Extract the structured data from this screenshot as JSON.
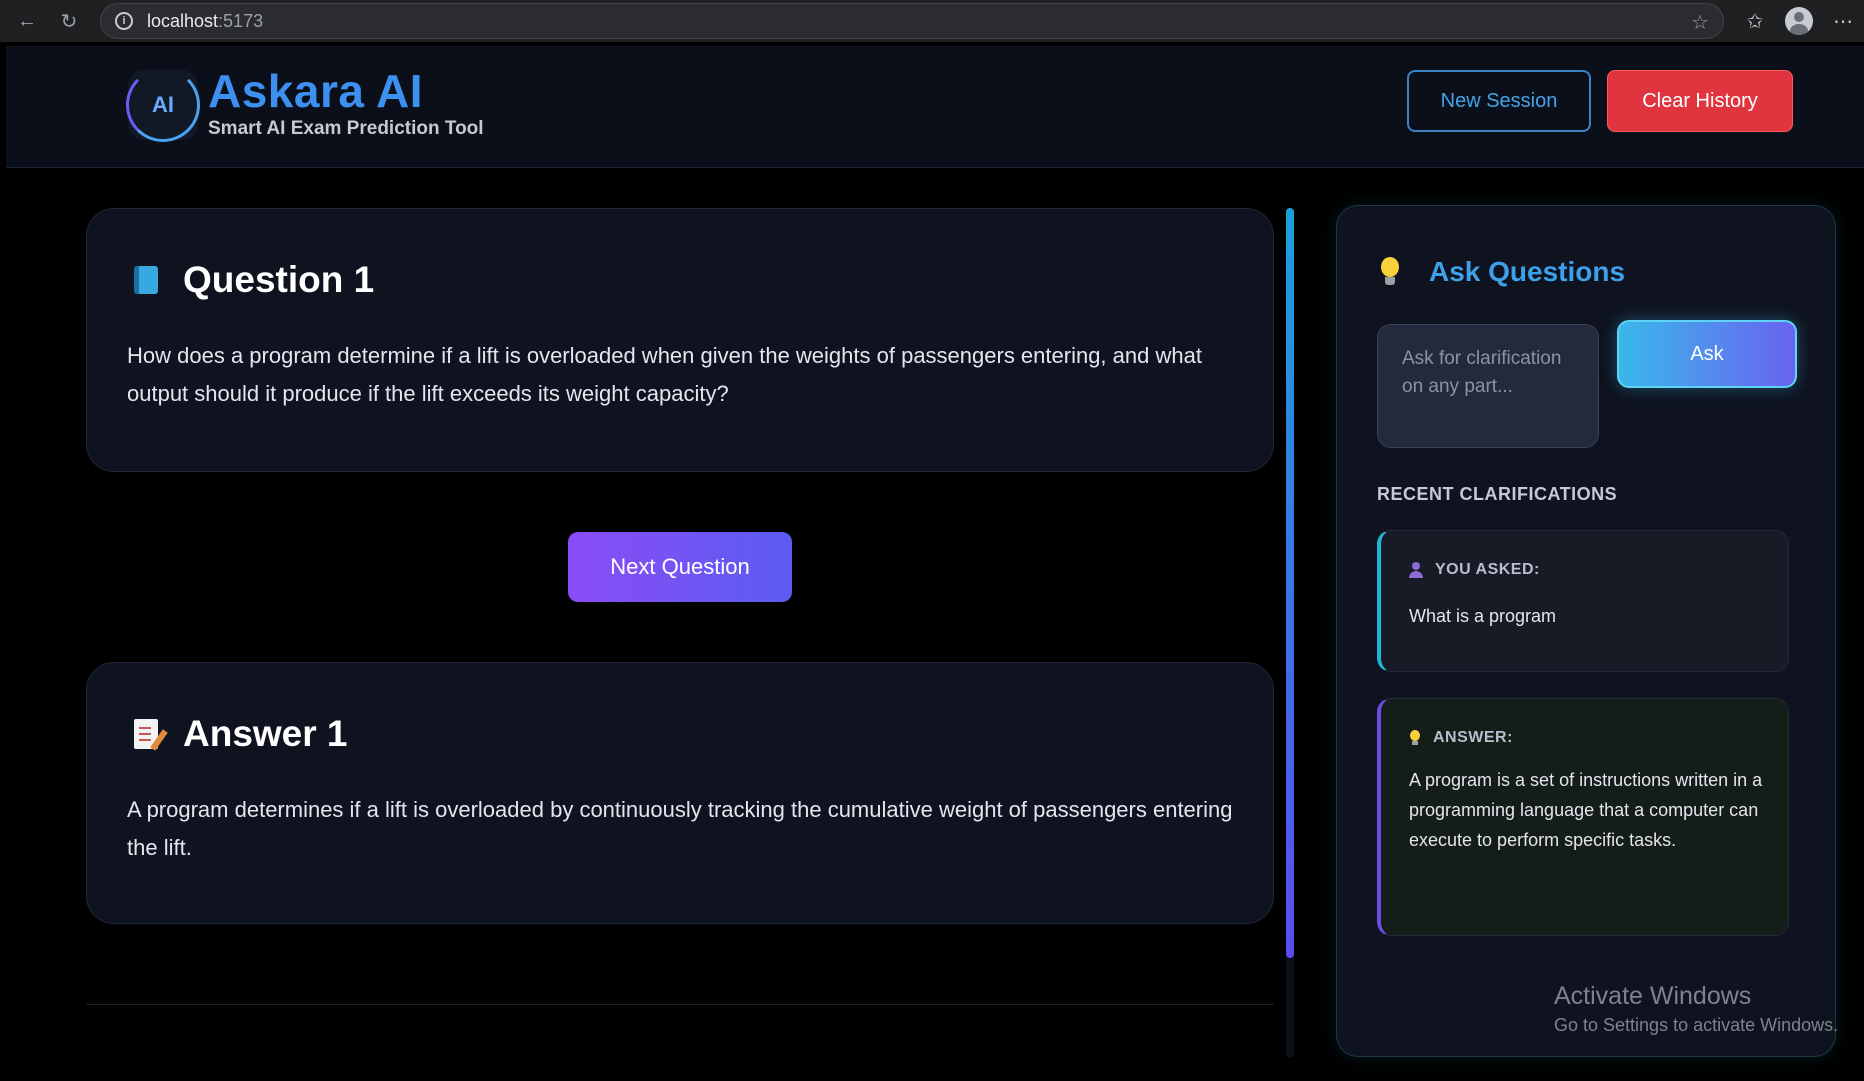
{
  "browser": {
    "url_host": "localhost",
    "url_port": ":5173"
  },
  "header": {
    "logo_text": "AI",
    "title": "Askara AI",
    "subtitle": "Smart AI Exam Prediction Tool",
    "new_session_label": "New Session",
    "clear_history_label": "Clear History"
  },
  "question": {
    "title": "Question 1",
    "text": "How does a program determine if a lift is overloaded when given the weights of passengers entering, and what output should it produce if the lift exceeds its weight capacity?"
  },
  "next_label": "Next Question",
  "answer": {
    "title": "Answer 1",
    "text": "A program determines if a lift is overloaded by continuously tracking the cumulative weight of passengers entering the lift."
  },
  "side": {
    "title": "Ask Questions",
    "input_placeholder": "Ask for clarification on any part...",
    "ask_label": "Ask",
    "recent_label": "RECENT CLARIFICATIONS",
    "items": [
      {
        "label": "YOU ASKED:",
        "text": "What is a program"
      },
      {
        "label": "ANSWER:",
        "text": "A program is a set of instructions written in a programming language that a computer can execute to perform specific tasks."
      }
    ]
  },
  "watermark": {
    "line1": "Activate Windows",
    "line2": "Go to Settings to activate Windows."
  },
  "colors": {
    "accent_blue": "#3d8ff0",
    "danger": "#e0353f",
    "purple": "#8b4cf6"
  }
}
